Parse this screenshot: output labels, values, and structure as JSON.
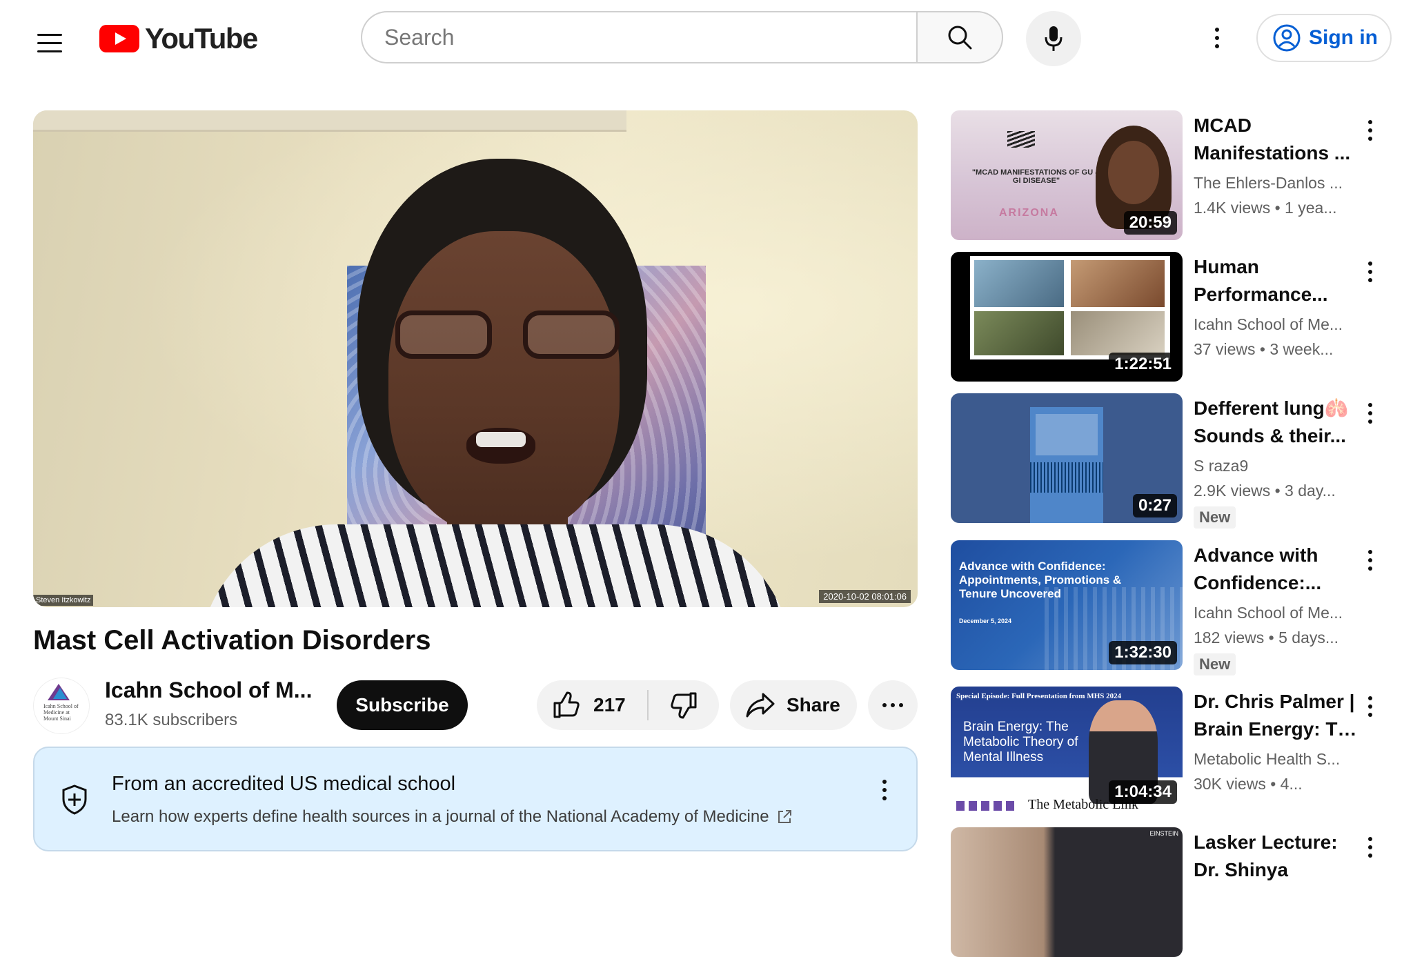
{
  "header": {
    "logo_text": "YouTube",
    "search_placeholder": "Search",
    "sign_in_label": "Sign in"
  },
  "video": {
    "title": "Mast Cell Activation Disorders",
    "overlay_name": "Steven Itzkowitz",
    "overlay_timestamp": "2020-10-02  08:01:06",
    "channel": {
      "name": "Icahn School of M...",
      "subscribers": "83.1K subscribers",
      "avatar_text": "Icahn School of Medicine at Mount Sinai"
    },
    "subscribe_label": "Subscribe",
    "likes": "217",
    "share_label": "Share"
  },
  "info_panel": {
    "heading": "From an accredited US medical school",
    "subtext": "Learn how experts define health sources in a journal of the National Academy of Medicine"
  },
  "recommendations": [
    {
      "title_line1": "MCAD",
      "title_line2": "Manifestations ...",
      "channel": "The Ehlers-Danlos ...",
      "meta": "1.4K views  • 1 yea...",
      "duration": "20:59",
      "thumb_text": "\"MCAD MANIFESTATIONS OF GU & GI DISEASE\"",
      "thumb_sub": "ARIZONA"
    },
    {
      "title_line1": "Human",
      "title_line2": "Performance...",
      "channel": "Icahn School of Me...",
      "meta": "37 views  • 3 week...",
      "duration": "1:22:51"
    },
    {
      "title_line1": "Defferent lung🫁",
      "title_line2": "Sounds & their...",
      "channel": "S raza9",
      "meta": "2.9K views  • 3 day...",
      "duration": "0:27",
      "badge": "New"
    },
    {
      "title_line1": "Advance with",
      "title_line2": "Confidence:...",
      "channel": "Icahn School of Me...",
      "meta": "182 views  • 5 days...",
      "duration": "1:32:30",
      "badge": "New",
      "thumb_text": "Advance with Confidence: Appointments, Promotions & Tenure Uncovered",
      "thumb_date": "December 5, 2024"
    },
    {
      "title_line1": "Dr. Chris Palmer |",
      "title_line2": "Brain Energy: Th...",
      "channel": "Metabolic Health S...",
      "meta": "30K views  • 4...",
      "duration": "1:04:34",
      "thumb_top": "Special Episode: Full Presentation from MHS 2024",
      "thumb_text": "Brain Energy: The Metabolic Theory of Mental Illness",
      "thumb_bottom": "The Metabolic Link"
    },
    {
      "title_line1": "Lasker Lecture:",
      "title_line2": "Dr. Shinya",
      "thumb_label": "EINSTEIN"
    }
  ],
  "colors": {
    "youtube_red": "#ff0000",
    "link_blue": "#065fd4",
    "info_bg": "#def1ff"
  }
}
